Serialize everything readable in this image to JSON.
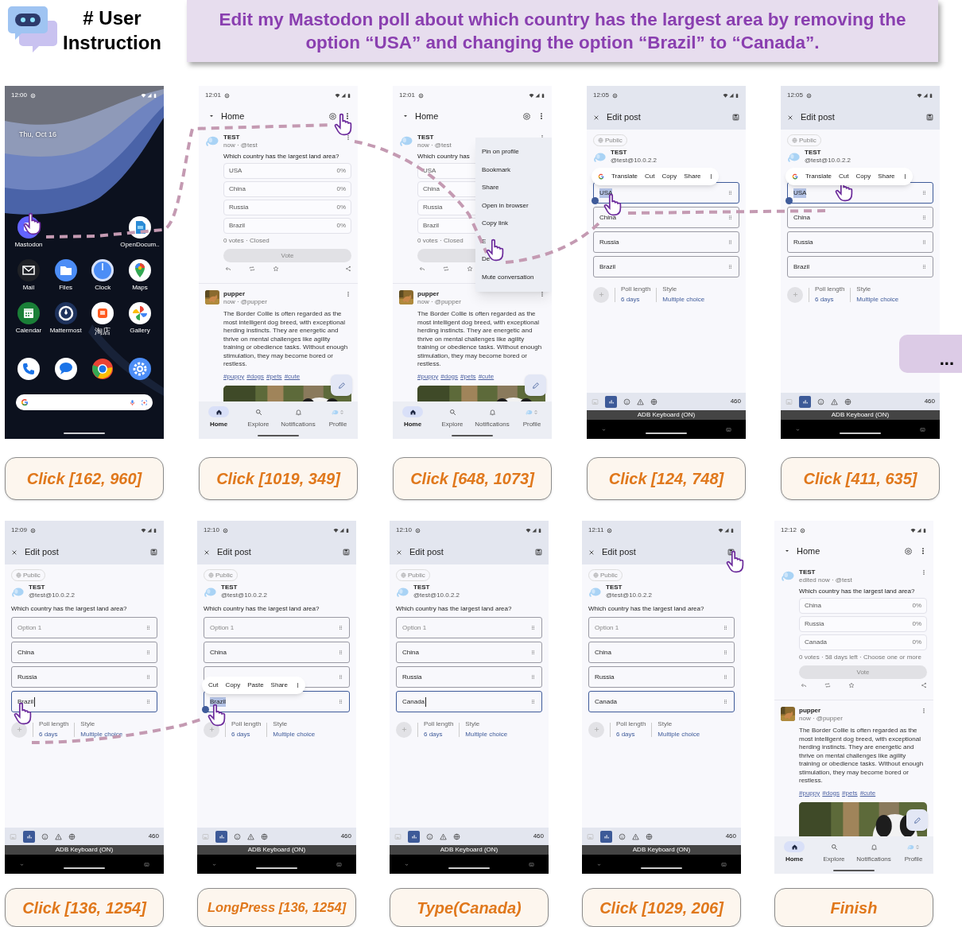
{
  "instruction": {
    "heading": "# User Instruction",
    "text": "Edit my Mastodon poll about which country has the largest area by removing the option “USA” and changing the option “Brazil” to “Canada”."
  },
  "steps": [
    {
      "action": "Click [162, 960]",
      "screen": {
        "kind": "launcher",
        "time": "12:00",
        "date": "Thu, Oct 16",
        "app_rows": [
          [
            {
              "label": "Mastodon"
            },
            {
              "label": "OpenDocum.."
            }
          ],
          [
            {
              "label": "Mail"
            },
            {
              "label": "Files"
            },
            {
              "label": "Clock"
            },
            {
              "label": "Maps"
            }
          ],
          [
            {
              "label": "Calendar"
            },
            {
              "label": "Mattermost"
            },
            {
              "label": "淘店"
            },
            {
              "label": "Gallery"
            }
          ]
        ]
      }
    },
    {
      "action": "Click [1019, 349]",
      "screen": {
        "kind": "feed",
        "time": "12:01",
        "title": "Home",
        "posts": [
          {
            "name": "TEST",
            "meta": "now · @test",
            "poll": {
              "question": "Which country has the largest land area?",
              "options": [
                {
                  "label": "USA",
                  "percent": "0%"
                },
                {
                  "label": "China",
                  "percent": "0%"
                },
                {
                  "label": "Russia",
                  "percent": "0%"
                },
                {
                  "label": "Brazil",
                  "percent": "0%"
                }
              ],
              "summary": "0 votes · Closed",
              "vote": "Vote"
            }
          },
          {
            "name": "pupper",
            "meta": "now · @pupper",
            "text": "The Border Collie is often regarded as the most intelligent dog breed, with exceptional herding instincts. They are energetic and thrive on mental challenges like agility training or obedience tasks. Without enough stimulation, they may become bored or restless.",
            "tags": [
              "#puppy",
              "#dogs",
              "#pets",
              "#cute"
            ]
          }
        ],
        "nav": [
          {
            "label": "Home",
            "selected": true
          },
          {
            "label": "Explore",
            "selected": false
          },
          {
            "label": "Notifications",
            "selected": false
          },
          {
            "label": "Profile",
            "selected": false
          }
        ]
      }
    },
    {
      "action": "Click [648, 1073]",
      "screen": {
        "kind": "feed",
        "time": "12:01",
        "title": "Home",
        "posts": [
          {
            "name": "TEST",
            "meta": "now · @test",
            "poll": {
              "question": "Which country has",
              "options": [
                {
                  "label": "USA"
                },
                {
                  "label": "China"
                },
                {
                  "label": "Russia"
                },
                {
                  "label": "Brazil"
                }
              ],
              "summary": "0 votes · Closed"
            }
          },
          {
            "name": "pupper",
            "meta": "now · @pupper",
            "text": "The Border Collie is often regarded as the most intelligent dog breed, with exceptional herding instincts. They are energetic and thrive on mental challenges like agility training or obedience tasks. Without enough stimulation, they may become bored or restless.",
            "tags": [
              "#puppy",
              "#dogs",
              "#pets",
              "#cute"
            ]
          }
        ],
        "menu": [
          "Pin on profile",
          "Bookmark",
          "Share",
          "Open in browser",
          "Copy link",
          "E",
          "De",
          "Mute conversation"
        ],
        "nav": [
          {
            "label": "Home",
            "selected": true
          },
          {
            "label": "Explore",
            "selected": false
          },
          {
            "label": "Notifications",
            "selected": false
          },
          {
            "label": "Profile",
            "selected": false
          }
        ]
      }
    },
    {
      "action": "Click [124, 748]",
      "screen": {
        "kind": "edit",
        "time": "12:05",
        "title": "Edit post",
        "visibility": "Public",
        "name": "TEST",
        "handle": "@test@10.0.2.2",
        "options": [
          {
            "value": "USA",
            "focused": true,
            "highlighted": true,
            "caret": false
          },
          {
            "value": "China",
            "focused": false,
            "highlighted": false,
            "caret": false
          },
          {
            "value": "Russia",
            "focused": false,
            "highlighted": false,
            "caret": false
          },
          {
            "value": "Brazil",
            "focused": false,
            "highlighted": false,
            "caret": false
          }
        ],
        "selection_toolbar": {
          "logo": true,
          "items": [
            "Translate",
            "Cut",
            "Copy",
            "Share"
          ]
        },
        "poll_length_label": "Poll length",
        "poll_length": "6 days",
        "style_label": "Style",
        "style": "Multiple choice",
        "char_count": "460",
        "keyboard": "ADB Keyboard (ON)"
      }
    },
    {
      "action": "Click [411, 635]",
      "screen": {
        "kind": "edit",
        "time": "12:05",
        "title": "Edit post",
        "visibility": "Public",
        "name": "TEST",
        "handle": "@test@10.0.2.2",
        "options": [
          {
            "value": "USA",
            "focused": true,
            "highlighted": true,
            "caret": false
          },
          {
            "value": "China",
            "focused": false,
            "highlighted": false,
            "caret": false
          },
          {
            "value": "Russia",
            "focused": false,
            "highlighted": false,
            "caret": false
          },
          {
            "value": "Brazil",
            "focused": false,
            "highlighted": false,
            "caret": false
          }
        ],
        "selection_toolbar": {
          "logo": true,
          "items": [
            "Translate",
            "Cut",
            "Copy",
            "Share"
          ]
        },
        "poll_length_label": "Poll length",
        "poll_length": "6 days",
        "style_label": "Style",
        "style": "Multiple choice",
        "char_count": "460",
        "keyboard": "ADB Keyboard (ON)"
      }
    },
    {
      "action": "Click [136, 1254]",
      "screen": {
        "kind": "edit",
        "time": "12:09",
        "title": "Edit post",
        "visibility": "Public",
        "name": "TEST",
        "handle": "@test@10.0.2.2",
        "question": "Which country has the largest land area?",
        "options": [
          {
            "placeholder": "Option 1",
            "focused": false,
            "highlighted": false,
            "caret": false
          },
          {
            "value": "China",
            "focused": false,
            "highlighted": false,
            "caret": false
          },
          {
            "value": "Russia",
            "focused": false,
            "highlighted": false,
            "caret": false
          },
          {
            "value": "Brazil",
            "focused": true,
            "highlighted": false,
            "caret": true
          }
        ],
        "poll_length_label": "Poll length",
        "poll_length": "6 days",
        "style_label": "Style",
        "style": "Multiple choice",
        "char_count": "460",
        "keyboard": "ADB Keyboard (ON)"
      }
    },
    {
      "action": "LongPress [136, 1254]",
      "screen": {
        "kind": "edit",
        "time": "12:10",
        "title": "Edit post",
        "visibility": "Public",
        "name": "TEST",
        "handle": "@test@10.0.2.2",
        "question": "Which country has the largest land area?",
        "options": [
          {
            "placeholder": "Option 1",
            "focused": false,
            "highlighted": false,
            "caret": false
          },
          {
            "value": "China",
            "focused": false,
            "highlighted": false,
            "caret": false
          },
          {
            "focused": false
          },
          {
            "value": "Brazil",
            "focused": true,
            "highlighted": true,
            "caret": false
          }
        ],
        "selection_toolbar": {
          "items": [
            "Cut",
            "Copy",
            "Paste",
            "Share"
          ]
        },
        "poll_length_label": "Poll length",
        "poll_length": "6 days",
        "style_label": "Style",
        "style": "Multiple choice",
        "char_count": "460",
        "keyboard": "ADB Keyboard (ON)"
      }
    },
    {
      "action": "Type(Canada)",
      "screen": {
        "kind": "edit",
        "time": "12:10",
        "title": "Edit post",
        "visibility": "Public",
        "name": "TEST",
        "handle": "@test@10.0.2.2",
        "question": "Which country has the largest land area?",
        "options": [
          {
            "placeholder": "Option 1",
            "focused": false,
            "highlighted": false,
            "caret": false
          },
          {
            "value": "China",
            "focused": false,
            "highlighted": false,
            "caret": false
          },
          {
            "value": "Russia",
            "focused": false,
            "highlighted": false,
            "caret": false
          },
          {
            "value": "Canada",
            "focused": true,
            "highlighted": false,
            "caret": true
          }
        ],
        "poll_length_label": "Poll length",
        "poll_length": "6 days",
        "style_label": "Style",
        "style": "Multiple choice",
        "char_count": "460",
        "keyboard": "ADB Keyboard (ON)"
      }
    },
    {
      "action": "Click [1029, 206]",
      "screen": {
        "kind": "edit",
        "time": "12:11",
        "title": "Edit post",
        "visibility": "Public",
        "name": "TEST",
        "handle": "@test@10.0.2.2",
        "question": "Which country has the largest land area?",
        "options": [
          {
            "placeholder": "Option 1",
            "focused": false,
            "highlighted": false,
            "caret": false
          },
          {
            "value": "China",
            "focused": false,
            "highlighted": false,
            "caret": false
          },
          {
            "value": "Russia",
            "focused": false,
            "highlighted": false,
            "caret": false
          },
          {
            "value": "Canada",
            "focused": true,
            "highlighted": false,
            "caret": false
          }
        ],
        "poll_length_label": "Poll length",
        "poll_length": "6 days",
        "style_label": "Style",
        "style": "Multiple choice",
        "char_count": "460",
        "keyboard": "ADB Keyboard (ON)"
      }
    },
    {
      "action": "Finish",
      "screen": {
        "kind": "feed",
        "time": "12:12",
        "title": "Home",
        "posts": [
          {
            "name": "TEST",
            "meta": "edited now · @test",
            "poll": {
              "question": "Which country has the largest land area?",
              "options": [
                {
                  "label": "China",
                  "percent": "0%"
                },
                {
                  "label": "Russia",
                  "percent": "0%"
                },
                {
                  "label": "Canada",
                  "percent": "0%"
                }
              ],
              "summary": "0 votes · 58 days left · Choose one or more",
              "vote": "Vote"
            }
          },
          {
            "name": "pupper",
            "meta": "now · @pupper",
            "text": "The Border Collie is often regarded as the most intelligent dog breed, with exceptional herding instincts. They are energetic and thrive on mental challenges like agility training or obedience tasks. Without enough stimulation, they may become bored or restless.",
            "tags": [
              "#puppy",
              "#dogs",
              "#pets",
              "#cute"
            ]
          }
        ],
        "nav": [
          {
            "label": "Home",
            "selected": true
          },
          {
            "label": "Explore",
            "selected": false
          },
          {
            "label": "Notifications",
            "selected": false
          },
          {
            "label": "Profile",
            "selected": false
          }
        ]
      }
    }
  ],
  "more_marker": "..."
}
